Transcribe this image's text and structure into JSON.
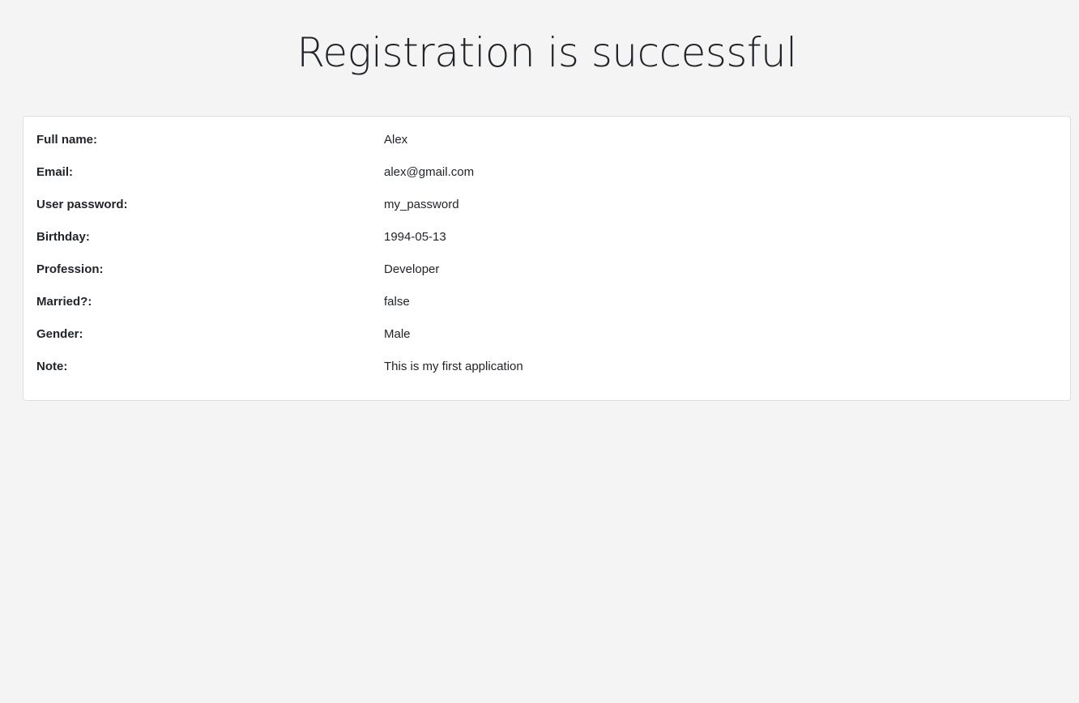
{
  "page": {
    "title": "Registration is successful"
  },
  "details": [
    {
      "label": "Full name:",
      "value": "Alex"
    },
    {
      "label": "Email:",
      "value": "alex@gmail.com"
    },
    {
      "label": "User password:",
      "value": "my_password"
    },
    {
      "label": "Birthday:",
      "value": "1994-05-13"
    },
    {
      "label": "Profession:",
      "value": "Developer"
    },
    {
      "label": "Married?:",
      "value": "false"
    },
    {
      "label": "Gender:",
      "value": "Male"
    },
    {
      "label": "Note:",
      "value": "This is my first application"
    }
  ]
}
